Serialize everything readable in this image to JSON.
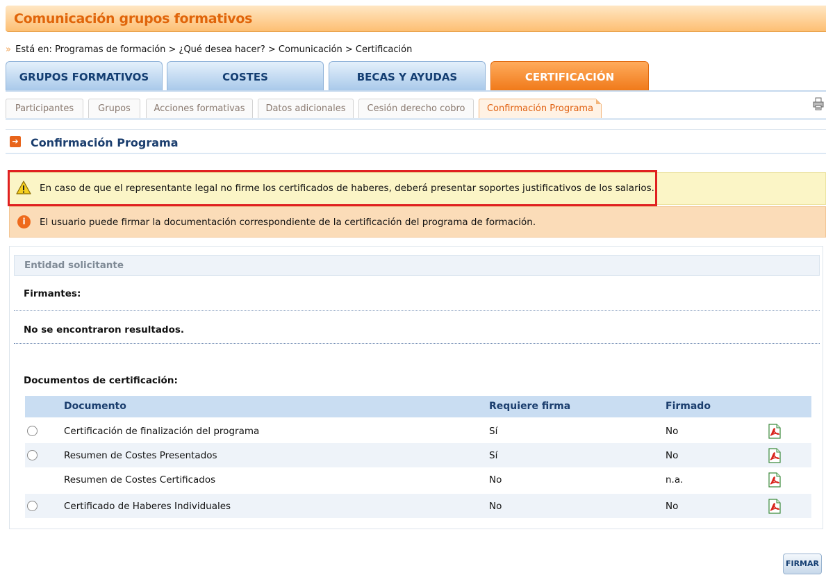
{
  "page_title": "Comunicación grupos formativos",
  "breadcrumb": {
    "prefix": "Está en:",
    "path": "Programas de formación > ¿Qué desea hacer? > Comunicación > Certificación"
  },
  "main_tabs": [
    {
      "label": "GRUPOS FORMATIVOS"
    },
    {
      "label": "COSTES"
    },
    {
      "label": "BECAS Y AYUDAS"
    },
    {
      "label": "CERTIFICACIÓN",
      "active": true
    }
  ],
  "sub_tabs": [
    {
      "label": "Participantes"
    },
    {
      "label": "Grupos"
    },
    {
      "label": "Acciones formativas"
    },
    {
      "label": "Datos adicionales"
    },
    {
      "label": "Cesión derecho cobro"
    },
    {
      "label": "Confirmación Programa",
      "active": true
    }
  ],
  "section_title": "Confirmación Programa",
  "warning_text": "En caso de que el representante legal no firme los certificados de haberes, deberá presentar soportes justificativos de los salarios.",
  "info_text": "El usuario puede firmar la documentación correspondiente de la certificación del programa de formación.",
  "entity": {
    "title": "Entidad solicitante",
    "signers_label": "Firmantes:",
    "no_results": "No se encontraron resultados.",
    "docs_label": "Documentos de certificación:"
  },
  "table": {
    "headers": {
      "document": "Documento",
      "requires": "Requiere firma",
      "signed": "Firmado"
    },
    "rows": [
      {
        "document": "Certificación de finalización del programa",
        "requires": "Sí",
        "signed": "No",
        "selectable": true
      },
      {
        "document": "Resumen de Costes Presentados",
        "requires": "Sí",
        "signed": "No",
        "selectable": true
      },
      {
        "document": "Resumen de Costes Certificados",
        "requires": "No",
        "signed": "n.a.",
        "selectable": false
      },
      {
        "document": "Certificado de Haberes Individuales",
        "requires": "No",
        "signed": "No",
        "selectable": true
      }
    ]
  },
  "firmar_button": "FIRMAR",
  "icons": {
    "print": "printer-icon",
    "section": "arrow-right-icon",
    "warning": "warning-triangle-icon",
    "info": "info-icon",
    "pdf": "pdf-icon"
  },
  "colors": {
    "orange_accent": "#e0650a",
    "navy": "#1b3e6e",
    "warning_bg": "#fbf5c6",
    "info_bg": "#fbdcb8",
    "highlight_border": "#e02020"
  }
}
